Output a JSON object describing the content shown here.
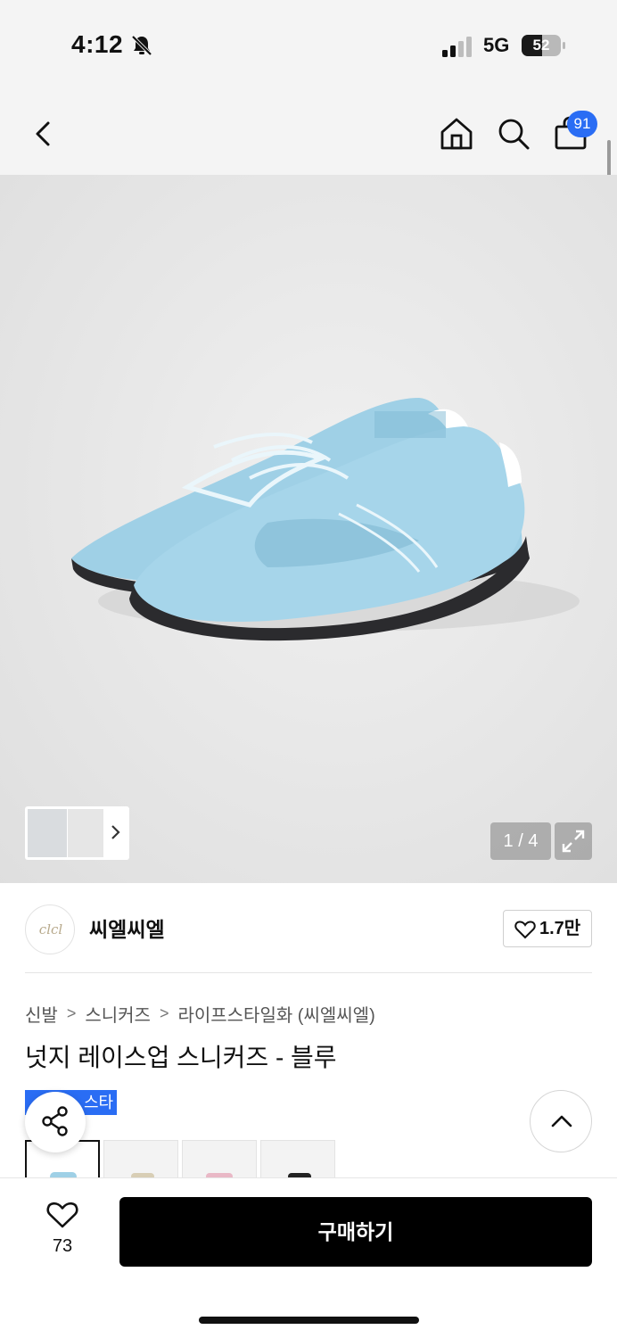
{
  "status_bar": {
    "time": "4:12",
    "network": "5G",
    "battery": 52,
    "bell_icon": "bell-slash-icon"
  },
  "header": {
    "back_icon": "chevron-left-icon",
    "home_icon": "home-icon",
    "search_icon": "search-icon",
    "cart_icon": "shopping-bag-icon",
    "cart_count": "91"
  },
  "gallery": {
    "page_counter": "1 / 4",
    "expand_icon": "expand-icon",
    "accent_color": "#9fd0e6"
  },
  "brand": {
    "name": "씨엘씨엘",
    "logo_text": "clcl",
    "likes": "1.7만"
  },
  "breadcrumb": [
    "신발",
    "스니커즈",
    "라이프스타일화 (씨엘씨엘)"
  ],
  "product": {
    "title": "넛지 레이스업 스니커즈 - 블루",
    "badge": "스타"
  },
  "bottom": {
    "wish_count": "73",
    "buy_label": "구매하기"
  },
  "colors": {
    "accent": "#2a6df4",
    "buy_button": "#000000"
  }
}
